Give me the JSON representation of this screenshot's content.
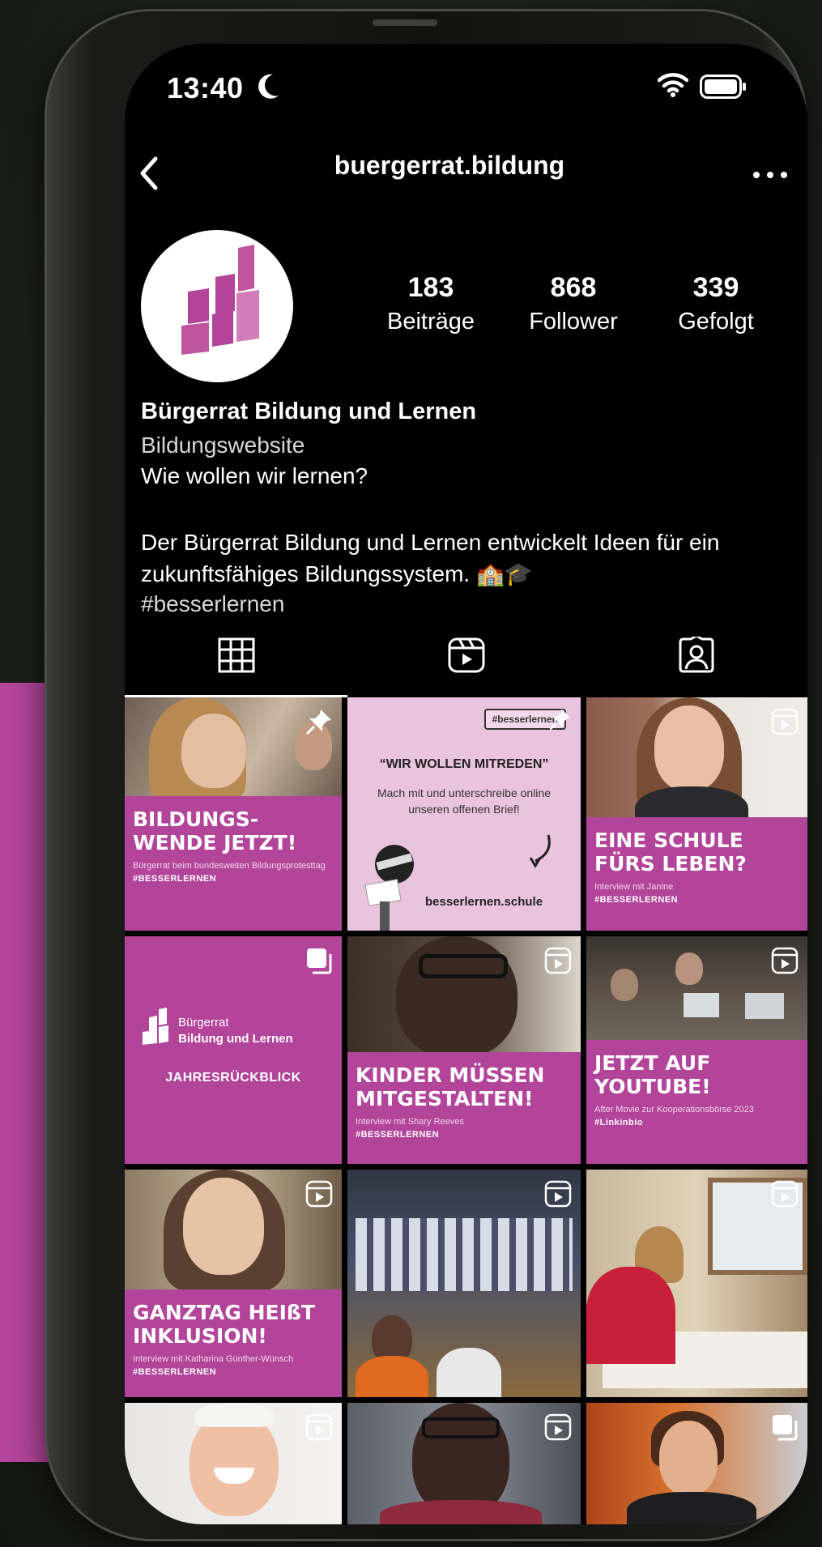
{
  "status_bar": {
    "time": "13:40"
  },
  "header": {
    "username": "buergerrat.bildung"
  },
  "profile": {
    "stats": [
      {
        "value": "183",
        "label": "Beiträge"
      },
      {
        "value": "868",
        "label": "Follower"
      },
      {
        "value": "339",
        "label": "Gefolgt"
      }
    ],
    "name": "Bürgerrat Bildung und Lernen",
    "category": "Bildungswebsite",
    "tagline": "Wie wollen wir lernen?",
    "bio": "Der Bürgerrat Bildung und Lernen entwickelt Ideen für ein zukunftsfähiges Bildungssystem. 🏫🎓",
    "hashtag": "#besserlernen"
  },
  "tabs": [
    "grid-icon",
    "reels-icon",
    "tagged-icon"
  ],
  "posts": [
    {
      "title": "BILDUNGS-\nWENDE JETZT!",
      "subtitle": "Bürgerrat beim bundesweiten Bildungsprotesttag",
      "tag": "#BESSERLERNEN",
      "overlay": "pin-icon"
    },
    {
      "sticker": "#besserlernen",
      "headline": "“WIR WOLLEN MITREDEN”",
      "body": "Mach mit und unterschreibe online unseren offenen Brief!",
      "url": "besserlernen.schule",
      "overlay": "pin-icon"
    },
    {
      "title": "EINE SCHULE\nFÜRS LEBEN?",
      "subtitle": "Interview mit Janine",
      "tag": "#BESSERLERNEN",
      "overlay": "reels-icon"
    },
    {
      "logo_line1": "Bürgerrat",
      "logo_line2": "Bildung und Lernen",
      "caption": "JAHRESRÜCKBLICK",
      "overlay": "carousel-icon"
    },
    {
      "title": "KINDER MÜSSEN\nMITGESTALTEN!",
      "subtitle": "Interview mit Shary Reeves",
      "tag": "#BESSERLERNEN",
      "overlay": "reels-icon"
    },
    {
      "title": "JETZT AUF\nYOUTUBE!",
      "subtitle": "After Movie zur Kooperationsbörse 2023",
      "tag": "#Linkinbio",
      "overlay": "reels-icon"
    },
    {
      "title": "GANZTAG HEIßT\nINKLUSION!",
      "subtitle": "Interview mit Katharina Günther-Wünsch",
      "tag": "#BESSERLERNEN",
      "overlay": "reels-icon"
    },
    {
      "overlay": "reels-icon"
    },
    {
      "overlay": "reels-icon"
    },
    {
      "overlay": "reels-icon"
    },
    {
      "overlay": "reels-icon"
    },
    {
      "overlay": "carousel-icon"
    }
  ],
  "colors": {
    "brand": "#b2449a",
    "background": "#000000",
    "text": "#ffffff"
  }
}
